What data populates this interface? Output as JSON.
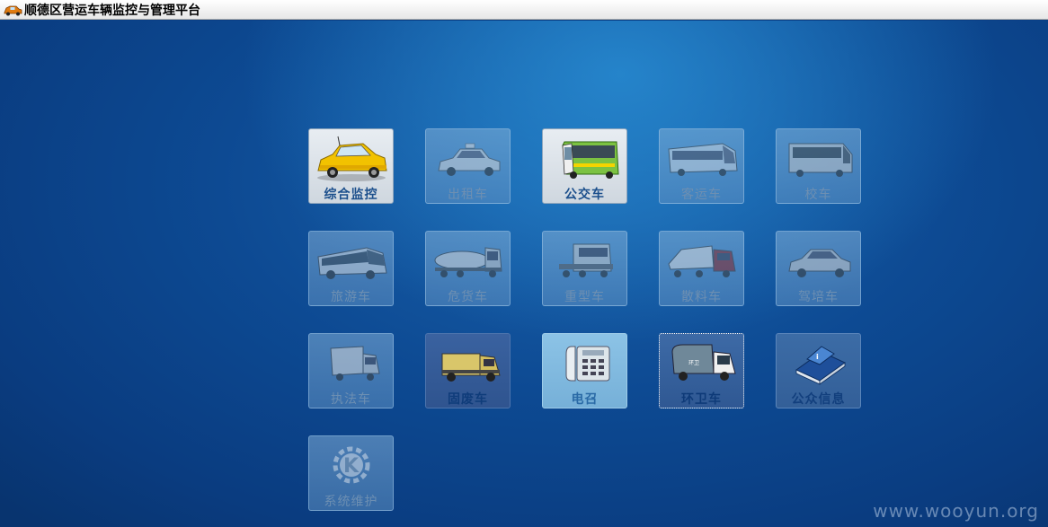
{
  "window": {
    "title": "顺德区营运车辆监控与管理平台",
    "icon": "car-icon"
  },
  "tiles": [
    {
      "label": "综合监控",
      "icon": "yellow-car-icon"
    },
    {
      "label": "出租车",
      "icon": "taxi-icon"
    },
    {
      "label": "公交车",
      "icon": "bus-icon"
    },
    {
      "label": "客运车",
      "icon": "coach-icon"
    },
    {
      "label": "校车",
      "icon": "school-bus-icon"
    },
    {
      "label": "旅游车",
      "icon": "tour-bus-icon"
    },
    {
      "label": "危货车",
      "icon": "tanker-truck-icon"
    },
    {
      "label": "重型车",
      "icon": "heavy-truck-icon"
    },
    {
      "label": "散料车",
      "icon": "bulk-truck-icon"
    },
    {
      "label": "驾培车",
      "icon": "training-car-icon"
    },
    {
      "label": "执法车",
      "icon": "law-van-icon"
    },
    {
      "label": "固废车",
      "icon": "waste-truck-icon"
    },
    {
      "label": "电召",
      "icon": "telephone-icon"
    },
    {
      "label": "环卫车",
      "icon": "sanitation-truck-icon"
    },
    {
      "label": "公众信息",
      "icon": "info-book-icon"
    },
    {
      "label": "系统维护",
      "icon": "gear-k-icon"
    }
  ],
  "watermark": "www.wooyun.org"
}
